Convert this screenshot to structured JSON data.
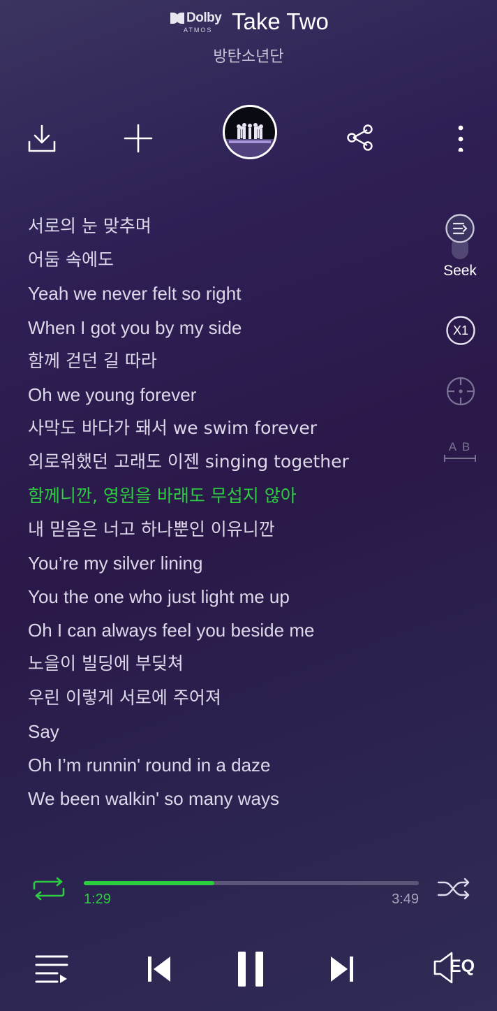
{
  "header": {
    "dolby_brand": "Dolby",
    "dolby_sub": "ATMOS",
    "title": "Take Two",
    "artist": "방탄소년단"
  },
  "actions": {
    "download_icon": "download-icon",
    "add_icon": "plus-icon",
    "share_icon": "share-icon",
    "more_icon": "more-vertical-icon"
  },
  "lyrics": {
    "active_index": 8,
    "lines": [
      "서로의 눈 맞추며",
      "어둠 속에도",
      "Yeah we never felt so right",
      "When I got you by my side",
      "함께 걷던 길 따라",
      "Oh we young forever",
      "사막도 바다가 돼서 we swim forever",
      "외로워했던 고래도 이젠 singing together",
      "함께니깐, 영원을 바래도 무섭지 않아",
      "내 믿음은 너고 하나뿐인 이유니깐",
      "You’re my silver lining",
      "You the one who just light me up",
      "Oh I can always feel you beside me",
      "노을이 빌딩에 부딪쳐",
      "우린 이렇게 서로에 주어져",
      "Say",
      "Oh I’m runnin' round in a daze",
      "We been walkin' so many ways"
    ]
  },
  "side_tools": {
    "seek_label": "Seek",
    "speed_label": "X1",
    "ab_label": "A B"
  },
  "progress": {
    "current": "1:29",
    "total": "3:49",
    "fraction": 0.389
  },
  "controls": {
    "eq_label": "EQ"
  },
  "colors": {
    "accent": "#2ecc40",
    "text": "#ddd9ea",
    "muted": "#a8a4bc"
  }
}
